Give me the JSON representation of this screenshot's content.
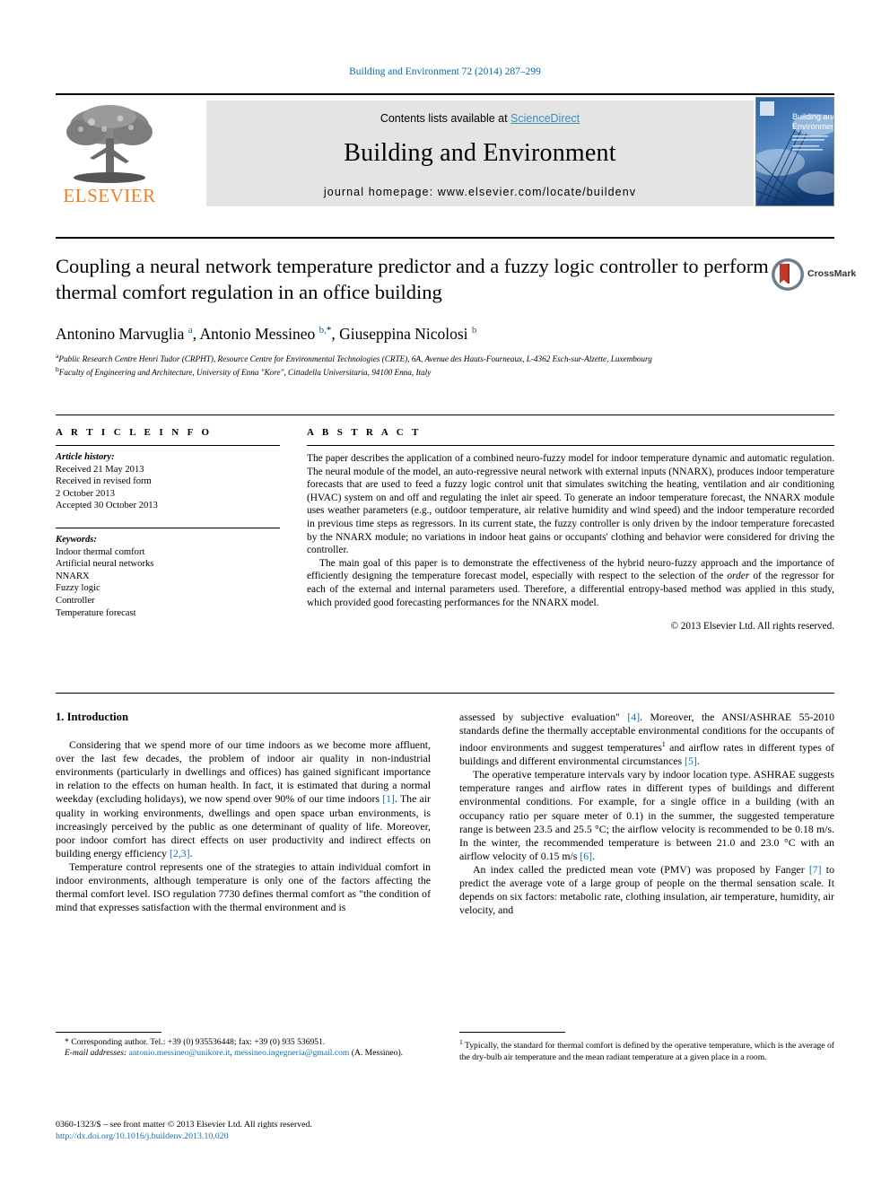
{
  "running_head": "Building and Environment 72 (2014) 287–299",
  "masthead": {
    "publisher": "ELSEVIER",
    "contents_prefix": "Contents lists available at ",
    "contents_link": "ScienceDirect",
    "journal_title": "Building and Environment",
    "homepage": "journal homepage: www.elsevier.com/locate/buildenv",
    "cover_title_line1": "Building and",
    "cover_title_line2": "Environment"
  },
  "article": {
    "title": "Coupling a neural network temperature predictor and a fuzzy logic controller to perform thermal comfort regulation in an office building",
    "crossmark_label": "CrossMark",
    "authors_html": "Antonino Marvuglia <sup class=\"sup\">a</sup>, Antonio Messineo <sup class=\"sup\">b,</sup><sup class=\"sup-star\">*</sup>, Giuseppina Nicolosi <sup class=\"sup\">b</sup>",
    "affiliation_a": "Public Research Centre Henri Tudor (CRPHT), Resource Centre for Environmental Technologies (CRTE), 6A, Avenue des Hauts-Fourneaux, L-4362 Esch-sur-Alzette, Luxembourg",
    "affiliation_b": "Faculty of Engineering and Architecture, University of Enna \"Kore\", Cittadella Universitaria, 94100 Enna, Italy"
  },
  "article_info": {
    "heading": "A R T I C L E  I N F O",
    "history_label": "Article history:",
    "history": [
      "Received 21 May 2013",
      "Received in revised form",
      "2 October 2013",
      "Accepted 30 October 2013"
    ],
    "keywords_label": "Keywords:",
    "keywords": [
      "Indoor thermal comfort",
      "Artificial neural networks",
      "NNARX",
      "Fuzzy logic",
      "Controller",
      "Temperature forecast"
    ]
  },
  "abstract": {
    "heading": "A B S T R A C T",
    "paragraph1": "The paper describes the application of a combined neuro-fuzzy model for indoor temperature dynamic and automatic regulation. The neural module of the model, an auto-regressive neural network with external inputs (NNARX), produces indoor temperature forecasts that are used to feed a fuzzy logic control unit that simulates switching the heating, ventilation and air conditioning (HVAC) system on and off and regulating the inlet air speed. To generate an indoor temperature forecast, the NNARX module uses weather parameters (e.g., outdoor temperature, air relative humidity and wind speed) and the indoor temperature recorded in previous time steps as regressors. In its current state, the fuzzy controller is only driven by the indoor temperature forecasted by the NNARX module; no variations in indoor heat gains or occupants' clothing and behavior were considered for driving the controller.",
    "paragraph2_html": "The main goal of this paper is to demonstrate the effectiveness of the hybrid neuro-fuzzy approach and the importance of efficiently designing the temperature forecast model, especially with respect to the selection of the <i>order</i> of the regressor for each of the external and internal parameters used. Therefore, a differential entropy-based method was applied in this study, which provided good forecasting performances for the NNARX model.",
    "copyright": "© 2013 Elsevier Ltd. All rights reserved."
  },
  "introduction": {
    "heading": "1. Introduction",
    "left_p1_html": "Considering that we spend more of our time indoors as we become more affluent, over the last few decades, the problem of indoor air quality in non-industrial environments (particularly in dwellings and offices) has gained significant importance in relation to the effects on human health. In fact, it is estimated that during a normal weekday (excluding holidays), we now spend over 90% of our time indoors <span class=\"ref\">[1]</span>. The air quality in working environments, dwellings and open space urban environments, is increasingly perceived by the public as one determinant of quality of life. Moreover, poor indoor comfort has direct effects on user productivity and indirect effects on building energy efficiency <span class=\"ref\">[2,3]</span>.",
    "left_p2_html": "Temperature control represents one of the strategies to attain individual comfort in indoor environments, although temperature is only one of the factors affecting the thermal comfort level. ISO regulation 7730 defines thermal comfort as \"the condition of mind that expresses satisfaction with the thermal environment and is",
    "right_p1_html": "assessed by subjective evaluation\" <span class=\"ref\">[4]</span>. Moreover, the ANSI/ASHRAE 55-2010 standards define the thermally acceptable environmental conditions for the occupants of indoor environments and suggest temperatures<span class=\"fnmark\">1</span> and airflow rates in different types of buildings and different environmental circumstances <span class=\"ref\">[5]</span>.",
    "right_p2_html": "The operative temperature intervals vary by indoor location type. ASHRAE suggests temperature ranges and airflow rates in different types of buildings and different environmental conditions. For example, for a single office in a building (with an occupancy ratio per square meter of 0.1) in the summer, the suggested temperature range is between 23.5 and 25.5 °C; the airflow velocity is recommended to be 0.18 m/s. In the winter, the recommended temperature is between 21.0 and 23.0 °C with an airflow velocity of 0.15 m/s <span class=\"ref\">[6]</span>.",
    "right_p3_html": "An index called the predicted mean vote (PMV) was proposed by Fanger <span class=\"ref\">[7]</span> to predict the average vote of a large group of people on the thermal sensation scale. It depends on six factors: metabolic rate, clothing insulation, air temperature, humidity, air velocity, and"
  },
  "footnotes": {
    "corresponding_html": "* Corresponding author. Tel.: +39 (0) 935536448; fax: +39 (0) 935 536951.",
    "email_html": "<i>E-mail addresses:</i> <span class=\"mail\">antonio.messineo@unikore.it</span>, <span class=\"mail\">messineo.ingegneria@gmail.com</span> (A. Messineo).",
    "footnote1_html": "<sup class=\"fn-sup\">1</sup> Typically, the standard for thermal comfort is defined by the operative temperature, which is the average of the dry-bulb air temperature and the mean radiant temperature at a given place in a room."
  },
  "imprint": {
    "line1": "0360-1323/$ – see front matter © 2013 Elsevier Ltd. All rights reserved.",
    "doi": "http://dx.doi.org/10.1016/j.buildenv.2013.10.020"
  }
}
